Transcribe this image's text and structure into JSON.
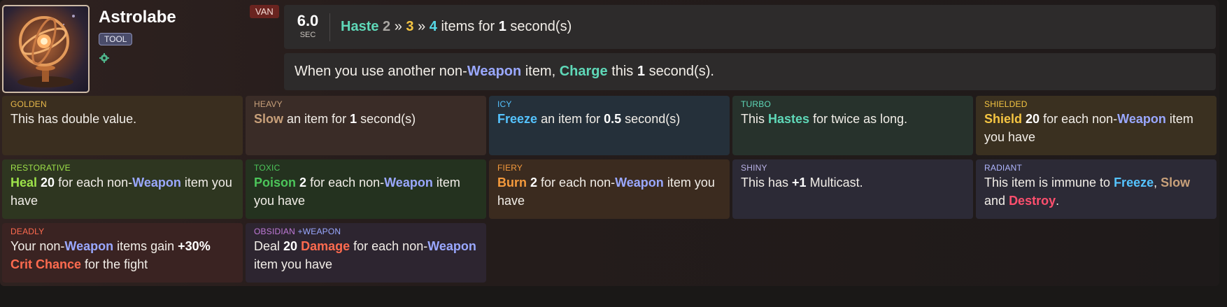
{
  "item": {
    "name": "Astrolabe",
    "tag": "TOOL",
    "hero_badge": "VAN",
    "owner_icon": "bronze-gear-icon"
  },
  "cooldown": {
    "value": "6.0",
    "unit": "SEC",
    "text": {
      "keyword": "Haste",
      "tier1": "2",
      "sep1": "»",
      "tier2": "3",
      "sep2": "»",
      "tier3": "4",
      "middle": "items for",
      "amount": "1",
      "suffix": "second(s)"
    }
  },
  "passive": {
    "pre": "When you use another non-",
    "weapon": "Weapon",
    "mid": "item,",
    "charge": "Charge",
    "this": "this",
    "amount": "1",
    "suffix": "second(s)."
  },
  "enchantments": {
    "golden": {
      "label": "GOLDEN",
      "text": "This has double value."
    },
    "heavy": {
      "label": "HEAVY",
      "kw": "Slow",
      "mid": "an item for",
      "num": "1",
      "suffix": "second(s)"
    },
    "icy": {
      "label": "ICY",
      "kw": "Freeze",
      "mid": "an item for",
      "num": "0.5",
      "suffix": "second(s)"
    },
    "turbo": {
      "label": "TURBO",
      "pre": "This",
      "kw": "Hastes",
      "suffix": "for twice as long."
    },
    "shielded": {
      "label": "SHIELDED",
      "kw": "Shield",
      "num": "20",
      "mid": "for each non-",
      "weapon": "Weapon",
      "suffix": "item you have"
    },
    "restorative": {
      "label": "RESTORATIVE",
      "kw": "Heal",
      "num": "20",
      "mid": "for each non-",
      "weapon": "Weapon",
      "suffix": "item you have"
    },
    "toxic": {
      "label": "TOXIC",
      "kw": "Poison",
      "num": "2",
      "mid": "for each non-",
      "weapon": "Weapon",
      "suffix": "item you have"
    },
    "fiery": {
      "label": "FIERY",
      "kw": "Burn",
      "num": "2",
      "mid": "for each non-",
      "weapon": "Weapon",
      "suffix": "item you have"
    },
    "shiny": {
      "label": "SHINY",
      "pre": "This has",
      "num": "+1",
      "suffix": "Multicast."
    },
    "radiant": {
      "label": "RADIANT",
      "pre": "This item is immune to",
      "kw1": "Freeze",
      "comma": ",",
      "kw2": "Slow",
      "and": "and",
      "kw3": "Destroy",
      "end": "."
    },
    "deadly": {
      "label": "DEADLY",
      "pre": "Your non-",
      "weapon": "Weapon",
      "mid": "items gain",
      "num": "+30%",
      "kw": "Crit Chance",
      "suffix": "for the fight"
    },
    "obsidian": {
      "label": "OBSIDIAN",
      "tag": "+WEAPON",
      "pre": "Deal",
      "num": "20",
      "kw": "Damage",
      "mid": "for each non-",
      "weapon": "Weapon",
      "suffix": "item you have"
    }
  }
}
